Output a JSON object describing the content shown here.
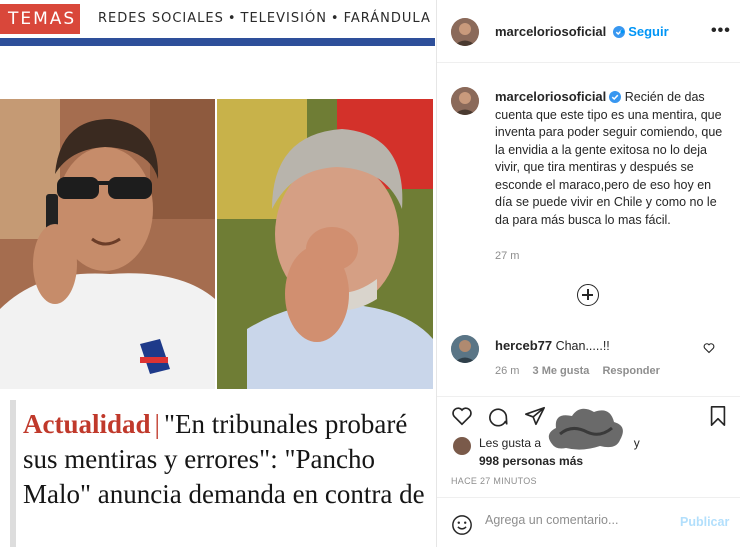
{
  "article": {
    "temas_label": "TEMAS",
    "topics": [
      "REDES SOCIALES",
      "TELEVISIÓN",
      "FARÁNDULA"
    ],
    "section": "Actualidad",
    "headline": "\"En tribunales probaré sus mentiras y errores\": \"Pancho Malo\" anuncia demanda en contra de"
  },
  "post": {
    "username": "marceloriosoficial",
    "follow_label": "Seguir",
    "separator": "•",
    "more_label": "•••",
    "caption": "Recién de das cuenta que este tipo es una mentira, que inventa para poder seguir comiendo, que la envidia a la gente exitosa no lo deja vivir, que tira mentiras y después se esconde el maraco,pero de eso hoy en día se puede vivir en Chile y como no le da para más busca lo mas fácil.",
    "caption_time": "27 m",
    "comment": {
      "username": "herceb77",
      "text": "Chan.....!!",
      "time": "26 m",
      "likes": "3 Me gusta",
      "reply": "Responder"
    },
    "likes_prefix": "Les gusta a",
    "likes_suffix": "y",
    "likes_count": "998 personas más",
    "posted_ago": "HACE 27 MINUTOS",
    "comment_placeholder": "Agrega un comentario...",
    "publish_label": "Publicar"
  },
  "colors": {
    "accent_blue": "#0095f6",
    "temas_red": "#d9473a",
    "rule_blue": "#2e4f9a",
    "section_red": "#c0392b"
  }
}
